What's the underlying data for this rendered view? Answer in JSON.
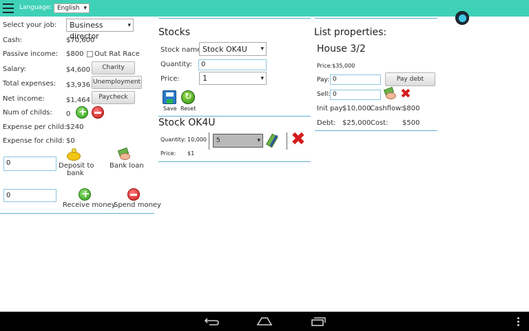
{
  "topbar": {
    "language_label": "Language:",
    "language_value": "English"
  },
  "left": {
    "job_label": "Select your job:",
    "job_value": "Business director",
    "cash_label": "Cash:",
    "cash_value": "$70,600",
    "passive_label": "Passive income:",
    "passive_value": "$800",
    "rat_race_label": "Out Rat Race",
    "salary_label": "Salary:",
    "salary_value": "$4,600",
    "charity_btn": "Charity",
    "expenses_label": "Total expenses:",
    "expenses_value": "$3,936",
    "unemployment_btn": "Unemployment",
    "net_label": "Net income:",
    "net_value": "$1,464",
    "paycheck_btn": "Paycheck",
    "childs_label": "Num of childs:",
    "childs_value": "0",
    "per_child_label": "Expense per child:",
    "per_child_value": "$240",
    "for_child_label": "Expense for child:",
    "for_child_value": "$0",
    "deposit_input": "0",
    "deposit_label_1": "Deposit to",
    "deposit_label_2": "bank",
    "bank_loan_label": "Bank loan",
    "money_input": "0",
    "receive_label": "Receive money",
    "spend_label": "Spend money"
  },
  "stocks": {
    "title": "Stocks",
    "name_label": "Stock name:",
    "name_value": "Stock OK4U",
    "quantity_label": "Quantity:",
    "quantity_value": "0",
    "price_label": "Price:",
    "price_value": "1",
    "save_label": "Save",
    "reset_label": "Reset",
    "owned_title": "Stock OK4U",
    "owned_qty_label": "Quantity:",
    "owned_qty_value": "10,000",
    "owned_price_label": "Price:",
    "owned_price_value": "$1",
    "owned_select": "5"
  },
  "props": {
    "title": "List properties:",
    "house_title": "House 3/2",
    "price_text": "Price:$35,000",
    "pay_label": "Pay:",
    "pay_value": "0",
    "pay_debt_btn": "Pay debt",
    "sell_label": "Sell:",
    "sell_value": "0",
    "init_pay_label": "Init pay:",
    "init_pay_value": "$10,000",
    "cashflow_label": "Cashflow:",
    "cashflow_value": "$800",
    "debt_label": "Debt:",
    "debt_value": "$25,000",
    "cost_label": "Cost:",
    "cost_value": "$500"
  },
  "colors": {
    "accent": "#3fd1b8",
    "divider": "#5fb0d0"
  }
}
